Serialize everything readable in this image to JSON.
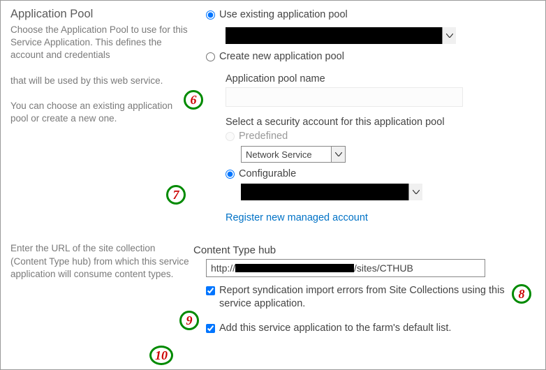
{
  "left": {
    "app_pool_title": "Application Pool",
    "app_pool_desc1": "Choose the Application Pool to use for this Service Application.  This defines the account and credentials",
    "app_pool_desc2": "that will be used by this web service.",
    "app_pool_desc3": "You can choose an existing application pool or create a new one.",
    "hub_desc": "Enter the URL of the site collection (Content Type hub) from which this service application will consume content types."
  },
  "right": {
    "use_existing_label": "Use existing application pool",
    "create_new_label": "Create new application pool",
    "pool_name_label": "Application pool name",
    "pool_name_value": "",
    "security_account_label": "Select a security account for this application pool",
    "predefined_label": "Predefined",
    "network_service_value": "Network Service",
    "configurable_label": "Configurable",
    "register_link": "Register new managed account",
    "cthub_label": "Content Type hub",
    "cthub_prefix": "http://",
    "cthub_suffix": "/sites/CTHUB",
    "report_errors_label": "Report syndication import errors from Site Collections using this service application.",
    "add_default_label": "Add this service application to the farm's default list."
  },
  "callouts": {
    "c6": "6",
    "c7": "7",
    "c8": "8",
    "c9": "9",
    "c10": "10"
  }
}
